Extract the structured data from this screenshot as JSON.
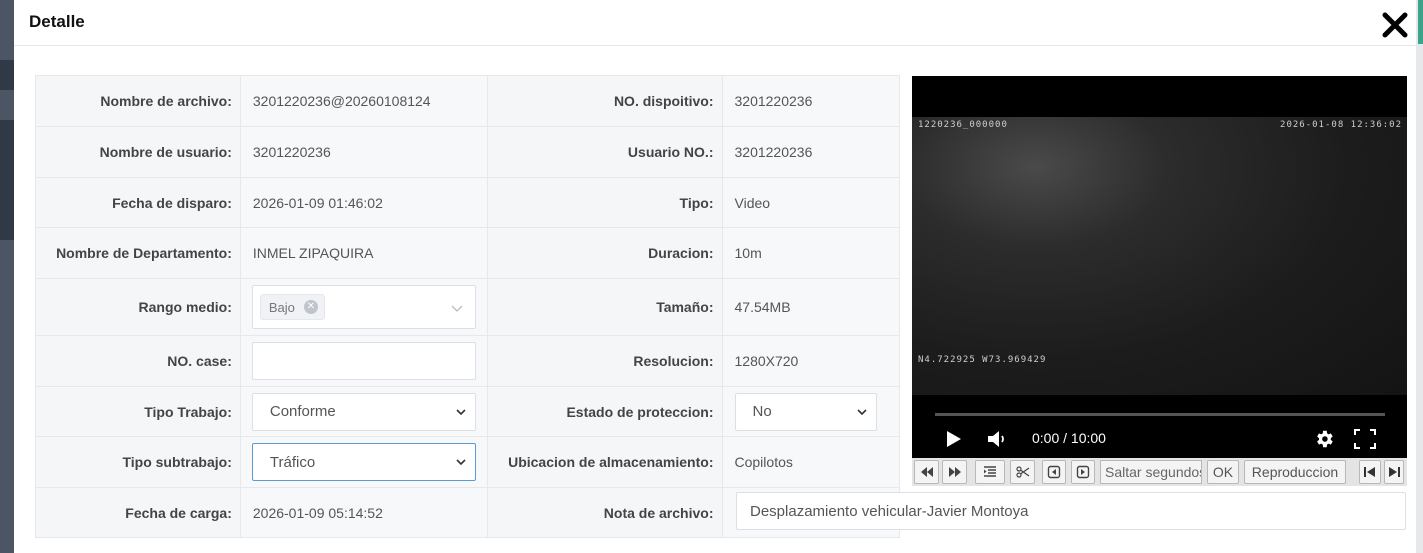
{
  "dialog": {
    "title": "Detalle",
    "close_icon": "close-icon"
  },
  "rows": {
    "file_name": {
      "label": "Nombre de archivo:",
      "value": "3201220236@20260108124"
    },
    "device_no": {
      "label": "NO. dispoitivo:",
      "value": "3201220236"
    },
    "user_name": {
      "label": "Nombre de usuario:",
      "value": "3201220236"
    },
    "user_no": {
      "label": "Usuario NO.:",
      "value": "3201220236"
    },
    "trigger_date": {
      "label": "Fecha de disparo:",
      "value": "2026-01-09 01:46:02"
    },
    "type": {
      "label": "Tipo:",
      "value": "Video"
    },
    "department": {
      "label": "Nombre de Departamento:",
      "value": "INMEL ZIPAQUIRA"
    },
    "duration": {
      "label": "Duracion:",
      "value": "10m"
    },
    "media_range": {
      "label": "Rango medio:",
      "tag": "Bajo"
    },
    "size": {
      "label": "Tamaño:",
      "value": "47.54MB"
    },
    "case_no": {
      "label": "NO. case:",
      "value": ""
    },
    "resolution": {
      "label": "Resolucion:",
      "value": "1280X720"
    },
    "work_type": {
      "label": "Tipo Trabajo:",
      "value": "Conforme"
    },
    "protection": {
      "label": "Estado de proteccion:",
      "value": "No"
    },
    "work_subtype": {
      "label": "Tipo subtrabajo:",
      "value": "Tráfico"
    },
    "storage": {
      "label": "Ubicacion de almacenamiento:",
      "value": "Copilotos"
    },
    "upload_date": {
      "label": "Fecha de carga:",
      "value": "2026-01-09 05:14:52"
    },
    "file_note": {
      "label": "Nota de archivo:",
      "value": "Desplazamiento vehicular-Javier Montoya"
    }
  },
  "video": {
    "osd_top_left": "1220236_000000",
    "osd_top_right": "2026-01-08 12:36:02",
    "osd_coords": "N4.722925 W73.969429",
    "time": "0:00 / 10:00",
    "progress": 0
  },
  "toolbar": {
    "skip_seconds_placeholder": "Saltar segundos",
    "ok_label": "OK",
    "playback_label": "Reproduccion"
  }
}
